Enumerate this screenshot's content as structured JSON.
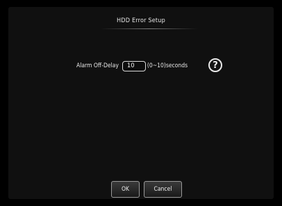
{
  "dialog": {
    "title": "HDD Error Setup"
  },
  "alarm_off_delay": {
    "label": "Alarm Off-Delay",
    "value": "10",
    "range_hint": "(0~10)seconds"
  },
  "help": {
    "glyph": "?",
    "icon": "question-mark-icon"
  },
  "buttons": {
    "ok_label": "OK",
    "cancel_label": "Cancel"
  },
  "colors": {
    "background": "#000000",
    "panel": "#101010",
    "text": "#e6e6e6"
  }
}
